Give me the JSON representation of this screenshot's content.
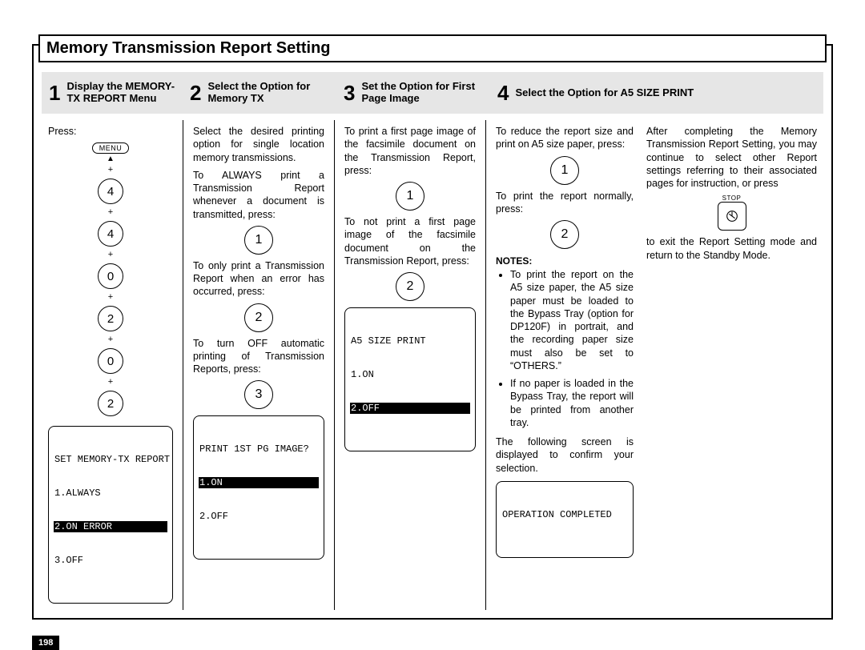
{
  "page_number": "198",
  "title": "Memory Transmission Report Setting",
  "steps": {
    "s1": {
      "num": "1",
      "title": "Display the MEMORY-TX REPORT Menu"
    },
    "s2": {
      "num": "2",
      "title": "Select the Option for Memory TX"
    },
    "s3": {
      "num": "3",
      "title": "Set the Option for First Page Image"
    },
    "s4": {
      "num": "4",
      "title": "Select the Option for A5 SIZE PRINT"
    }
  },
  "col1": {
    "press": "Press:",
    "menu_label": "MENU",
    "keys": [
      "4",
      "4",
      "0",
      "2",
      "0",
      "2"
    ],
    "lcd": {
      "l1": "SET MEMORY-TX REPORT",
      "l2": "1.ALWAYS",
      "l3": "2.ON ERROR",
      "l4": "3.OFF"
    }
  },
  "col2": {
    "p1": "Select the desired printing option for single location memory transmissions.",
    "p2": "To ALWAYS print a Transmission Report whenever a document is transmitted, press:",
    "k1": "1",
    "p3": "To only print a Transmission Report when an error has occurred, press:",
    "k2": "2",
    "p4": "To turn OFF automatic printing of Transmission Reports, press:",
    "k3": "3",
    "lcd": {
      "l1": "PRINT 1ST PG IMAGE?",
      "l2": "1.ON",
      "l3": "2.OFF"
    }
  },
  "col3": {
    "p1": "To print a first page image of the facsimile document on the Transmission Report, press:",
    "k1": "1",
    "p2": "To not print a first page image of the facsimile document on the Transmission Report, press:",
    "k2": "2",
    "lcd": {
      "l1": "A5 SIZE PRINT",
      "l2": "1.ON",
      "l3": "2.OFF"
    }
  },
  "col4": {
    "p1": "To reduce the report size and print on A5 size paper, press:",
    "k1": "1",
    "p2": "To print the report normally, press:",
    "k2": "2",
    "notes_h": "NOTES:",
    "note1": "To print the report on the A5 size paper, the A5 size paper must be loaded to the Bypass Tray (option for DP120F) in portrait, and the recording paper size must also be set to “OTHERS.”",
    "note2": "If no paper is loaded in the Bypass Tray, the report will be printed from another tray.",
    "p3": "The following screen is displayed to confirm your selection.",
    "lcd": {
      "l1": "OPERATION COMPLETED"
    }
  },
  "col5": {
    "p1": "After completing the Memory Transmission Report Setting, you may continue to select other Report settings referring to their associated pages for instruction, or press",
    "stop_label": "STOP",
    "p2": "to exit the Report Setting mode and return to the Standby Mode."
  }
}
